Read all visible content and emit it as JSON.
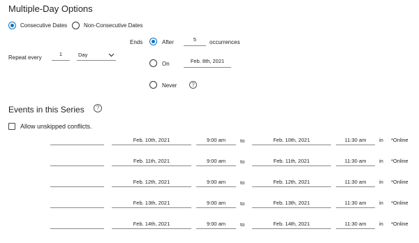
{
  "header": {
    "title": "Multiple-Day Options"
  },
  "mode": {
    "consecutive_label": "Consecutive Dates",
    "non_consecutive_label": "Non-Consecutive Dates",
    "selected": "consecutive"
  },
  "repeat": {
    "label": "Repeat every",
    "value": "1",
    "unit": "Day"
  },
  "ends": {
    "label": "Ends",
    "after_label": "After",
    "after_value": "5",
    "occurrences_label": "occurrences",
    "on_label": "On",
    "on_value": "Feb. 8th, 2021",
    "never_label": "Never",
    "selected": "after"
  },
  "series": {
    "title": "Events in this Series",
    "allow_conflicts_label": "Allow unskipped conflicts.",
    "to_label": "to",
    "in_label": "in",
    "rows": [
      {
        "start_date": "Feb. 10th, 2021",
        "start_time": "9:00 am",
        "end_date": "Feb. 10th, 2021",
        "end_time": "11:30 am",
        "location": "*Online"
      },
      {
        "start_date": "Feb. 11th, 2021",
        "start_time": "9:00 am",
        "end_date": "Feb. 11th, 2021",
        "end_time": "11:30 am",
        "location": "*Online"
      },
      {
        "start_date": "Feb. 12th, 2021",
        "start_time": "9:00 am",
        "end_date": "Feb. 12th, 2021",
        "end_time": "11:30 am",
        "location": "*Online"
      },
      {
        "start_date": "Feb. 13th, 2021",
        "start_time": "9:00 am",
        "end_date": "Feb. 13th, 2021",
        "end_time": "11:30 am",
        "location": "*Online"
      },
      {
        "start_date": "Feb. 14th, 2021",
        "start_time": "9:00 am",
        "end_date": "Feb. 14th, 2021",
        "end_time": "11:30 am",
        "location": "*Online"
      }
    ]
  },
  "colors": {
    "accent": "#0a72c0",
    "line": "#888888"
  }
}
